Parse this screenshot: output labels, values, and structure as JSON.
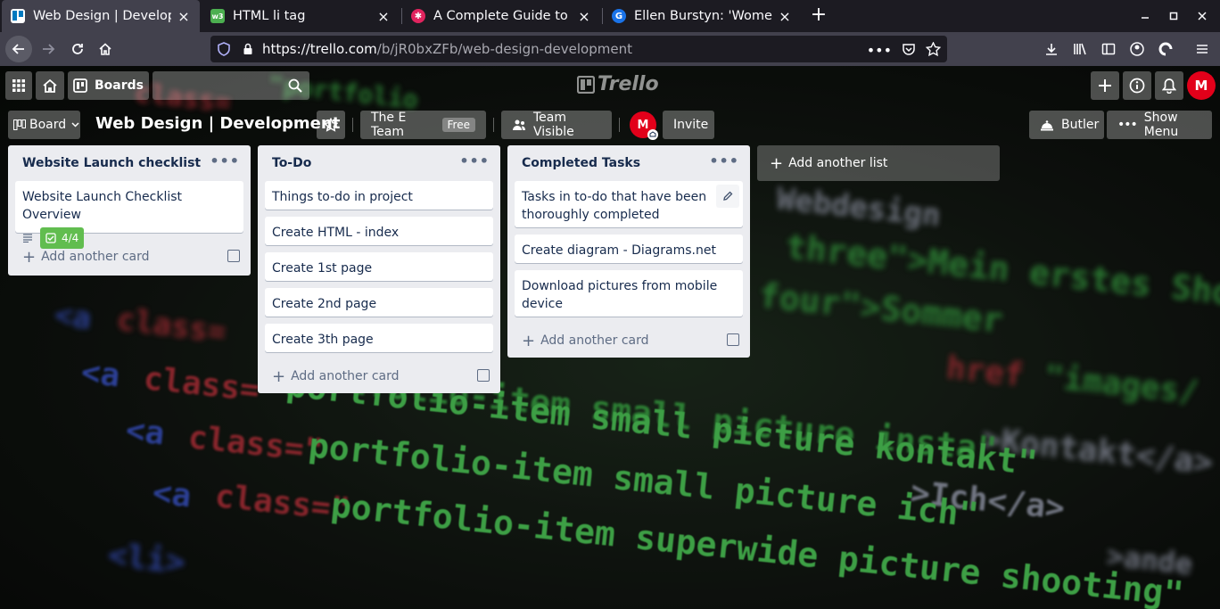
{
  "browser": {
    "tabs": [
      {
        "title": "Web Design | Developme",
        "close": "×",
        "favicon_color": "#0079bf",
        "active": true
      },
      {
        "title": "HTML li tag",
        "close": "×",
        "favicon_color": "#4caf50",
        "active": false
      },
      {
        "title": "A Complete Guide to Fle",
        "close": "×",
        "favicon_color": "#e0245e",
        "active": false
      },
      {
        "title": "Ellen Burstyn: 'Women o",
        "close": "×",
        "favicon_color": "#1a73e8",
        "active": false
      }
    ],
    "new_tab": "+",
    "url_host": "https://trello.com",
    "url_path": "/b/jR0bxZFb/web-design-development"
  },
  "trello_header": {
    "boards_label": "Boards",
    "logo_text": "Trello",
    "user_initial": "M"
  },
  "board": {
    "view_label": "Board",
    "title": "Web Design | Development",
    "team_name": "The E Team",
    "team_plan": "Free",
    "visibility": "Team Visible",
    "member_initial": "M",
    "invite_label": "Invite",
    "butler_label": "Butler",
    "show_menu_label": "Show Menu",
    "add_list_label": "Add another list",
    "add_card_label": "Add another card"
  },
  "lists": [
    {
      "name": "Website Launch checklist",
      "cards": [
        {
          "text": "Website Launch Checklist Overview",
          "checklist": "4/4"
        }
      ]
    },
    {
      "name": "To-Do",
      "cards": [
        {
          "text": "Things to-do in project"
        },
        {
          "text": "Create HTML - index"
        },
        {
          "text": "Create 1st page"
        },
        {
          "text": "Create 2nd page"
        },
        {
          "text": "Create 3th page"
        }
      ]
    },
    {
      "name": "Completed Tasks",
      "cards": [
        {
          "text": "Tasks in to-do that have been thoroughly completed"
        },
        {
          "text": "Create diagram - Diagrams.net"
        },
        {
          "text": "Download pictures from mobile device"
        }
      ]
    }
  ],
  "colors": {
    "list_bg": "#ebecf0",
    "checklist_done": "#61bd4f",
    "avatar": "#e2001a"
  }
}
